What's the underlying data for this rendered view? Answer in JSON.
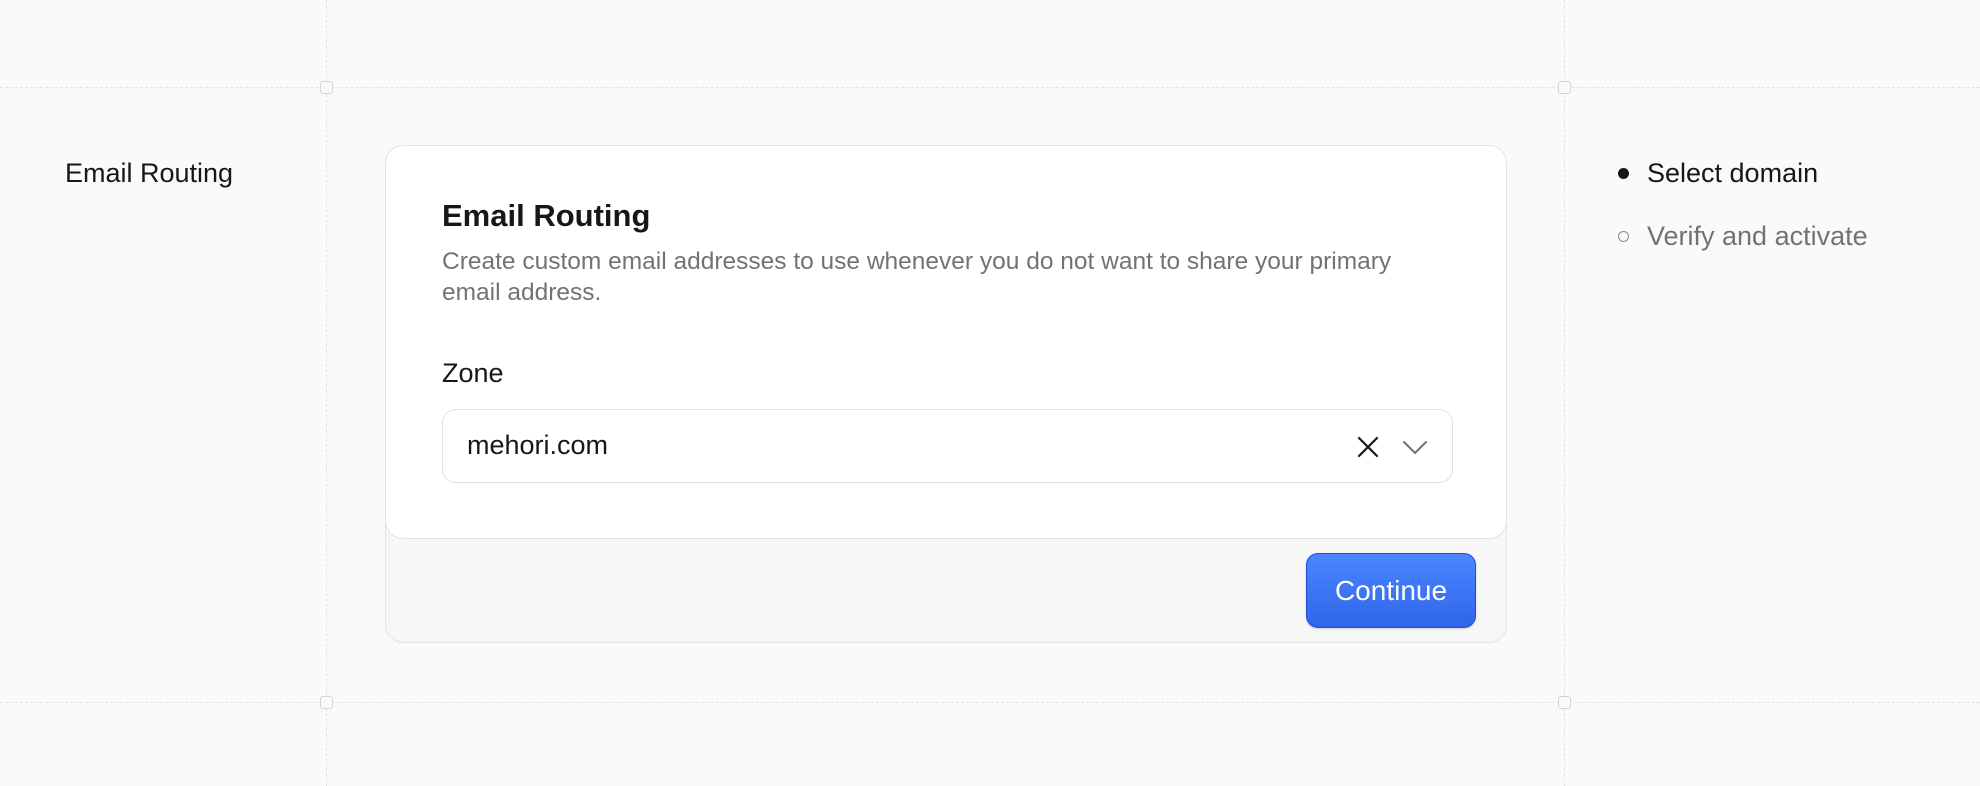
{
  "left_panel": {
    "title": "Email Routing"
  },
  "card": {
    "title": "Email Routing",
    "description": "Create custom email addresses to use whenever you do not want to share your primary email address.",
    "zone_field": {
      "label": "Zone",
      "value": "mehori.com",
      "clear_icon": "close-icon",
      "dropdown_icon": "chevron-down-icon"
    },
    "continue_label": "Continue"
  },
  "steps": {
    "items": [
      {
        "label": "Select domain",
        "state": "active"
      },
      {
        "label": "Verify and activate",
        "state": "inactive"
      }
    ]
  },
  "colors": {
    "accent": "#3b74f5",
    "text_primary": "#171717",
    "text_muted": "#737373",
    "background": "#fafafa"
  }
}
